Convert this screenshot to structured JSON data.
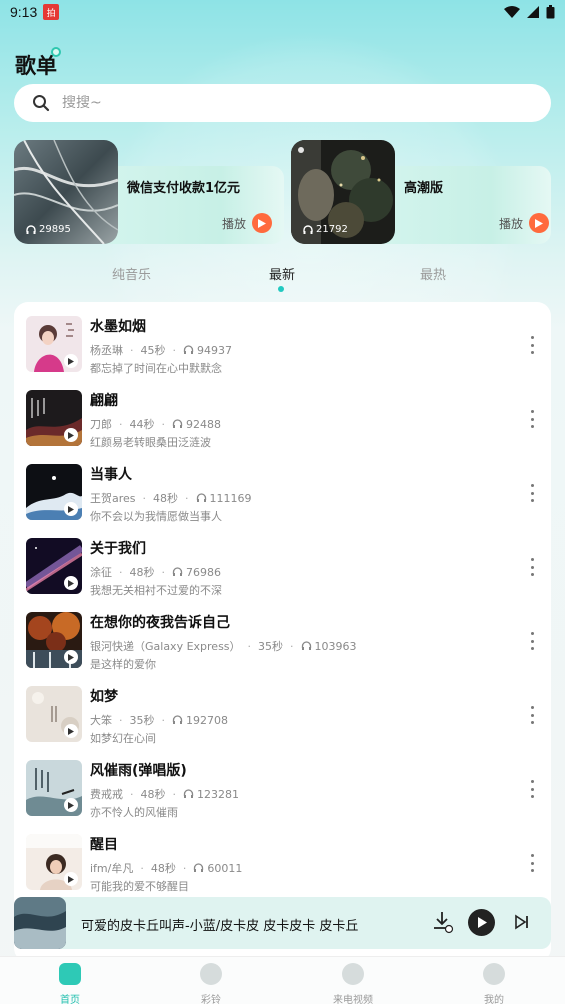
{
  "status_bar": {
    "time": "9:13",
    "app_badge": "拍"
  },
  "header": {
    "title": "歌单"
  },
  "search": {
    "placeholder": "搜搜~"
  },
  "featured": [
    {
      "title": "微信支付收款1亿元",
      "play_count": "29895",
      "play_label": "播放"
    },
    {
      "title": "高潮版",
      "play_count": "21792",
      "play_label": "播放"
    }
  ],
  "tabs": [
    {
      "label": "纯音乐",
      "active": false
    },
    {
      "label": "最新",
      "active": true
    },
    {
      "label": "最热",
      "active": false
    }
  ],
  "songs": [
    {
      "title": "水墨如烟",
      "artist": "杨丞琳",
      "duration": "45秒",
      "plays": "94937",
      "desc": "都忘掉了时间在心中默默念"
    },
    {
      "title": "翩翩",
      "artist": "刀郎",
      "duration": "44秒",
      "plays": "92488",
      "desc": "红颜易老转眼桑田泛涟波"
    },
    {
      "title": "当事人",
      "artist": "王贺ares",
      "duration": "48秒",
      "plays": "111169",
      "desc": "你不会以为我情愿做当事人"
    },
    {
      "title": "关于我们",
      "artist": "涂征",
      "duration": "48秒",
      "plays": "76986",
      "desc": "我想无关相衬不过爱的不深"
    },
    {
      "title": "在想你的夜我告诉自己",
      "artist": "银河快递（Galaxy Express）",
      "duration": "35秒",
      "plays": "103963",
      "desc": "是这样的爱你"
    },
    {
      "title": "如梦",
      "artist": "大笨",
      "duration": "35秒",
      "plays": "192708",
      "desc": "如梦幻在心间"
    },
    {
      "title": "风催雨(弹唱版)",
      "artist": "费戒戒",
      "duration": "48秒",
      "plays": "123281",
      "desc": "亦不怜人的风催雨"
    },
    {
      "title": "醒目",
      "artist": "ifm/牟凡",
      "duration": "48秒",
      "plays": "60011",
      "desc": "可能我的爱不够醒目"
    }
  ],
  "player": {
    "title": "可爱的皮卡丘叫声-小蓝/皮卡皮 皮卡皮卡 皮卡丘"
  },
  "bottom_nav": [
    {
      "label": "首页",
      "icon": "home-icon",
      "active": true
    },
    {
      "label": "彩铃",
      "icon": "bell-icon",
      "active": false
    },
    {
      "label": "来电视频",
      "icon": "phone-icon",
      "active": false
    },
    {
      "label": "我的",
      "icon": "profile-icon",
      "active": false
    }
  ],
  "colors": {
    "accent": "#22c9c0",
    "play_orange": "#ff6a3d"
  }
}
